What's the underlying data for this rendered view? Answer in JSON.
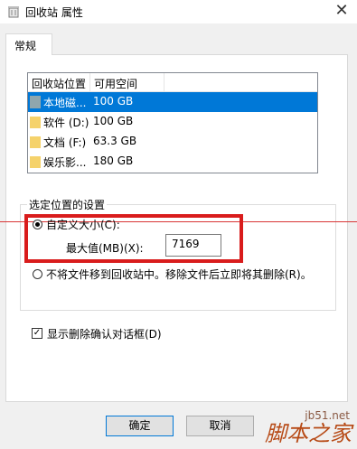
{
  "window": {
    "title": "回收站 属性",
    "close_glyph": "✕"
  },
  "tabs": [
    {
      "label": "常规",
      "active": true
    }
  ],
  "list": {
    "columns": [
      "回收站位置",
      "可用空间"
    ],
    "rows": [
      {
        "name": "本地磁...",
        "space": "100 GB",
        "icon": "drive-icon",
        "selected": true
      },
      {
        "name": "软件 (D:)",
        "space": "100 GB",
        "icon": "folder-icon",
        "selected": false
      },
      {
        "name": "文档 (F:)",
        "space": "63.3 GB",
        "icon": "folder-icon",
        "selected": false
      },
      {
        "name": "娱乐影...",
        "space": "180 GB",
        "icon": "folder-icon",
        "selected": false
      }
    ]
  },
  "settings": {
    "group_title": "选定位置的设置",
    "custom_size_label": "自定义大小(C):",
    "max_size_label": "最大值(MB)(X):",
    "max_size_value": "7169",
    "delete_immediately_label": "不将文件移到回收站中。移除文件后立即将其删除(R)。",
    "custom_size_selected": true
  },
  "confirm_dialog": {
    "label": "显示删除确认对话框(D)",
    "checked": true
  },
  "buttons": {
    "ok": "确定",
    "cancel": "取消"
  },
  "watermark": {
    "url": "jb51.net",
    "brand": "脚本之家"
  },
  "colors": {
    "selection": "#0078d7",
    "highlight_red": "#d91c1c",
    "folder_yellow": "#f5d26b",
    "drive_gray": "#8fa6ad"
  }
}
